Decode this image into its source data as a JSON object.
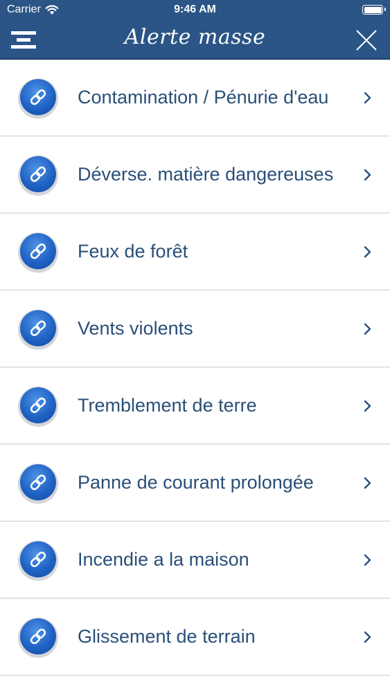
{
  "status_bar": {
    "carrier": "Carrier",
    "time": "9:46 AM",
    "wifi_icon": "wifi-icon",
    "battery_icon": "battery-icon"
  },
  "nav": {
    "title": "Alerte masse",
    "menu_icon": "menu-icon",
    "close_icon": "close-icon",
    "background_color": "#2b5586"
  },
  "list": {
    "item_icon": "link-icon",
    "chevron_icon": "chevron-right-icon",
    "text_color": "#2a4f78",
    "items": [
      {
        "label": "Contamination / Pénurie d'eau"
      },
      {
        "label": "Déverse. matière dangereuses"
      },
      {
        "label": "Feux  de forêt"
      },
      {
        "label": "Vents violents"
      },
      {
        "label": "Tremblement de terre"
      },
      {
        "label": "Panne de courant prolongée"
      },
      {
        "label": "Incendie a la maison"
      },
      {
        "label": "Glissement de terrain"
      }
    ]
  }
}
